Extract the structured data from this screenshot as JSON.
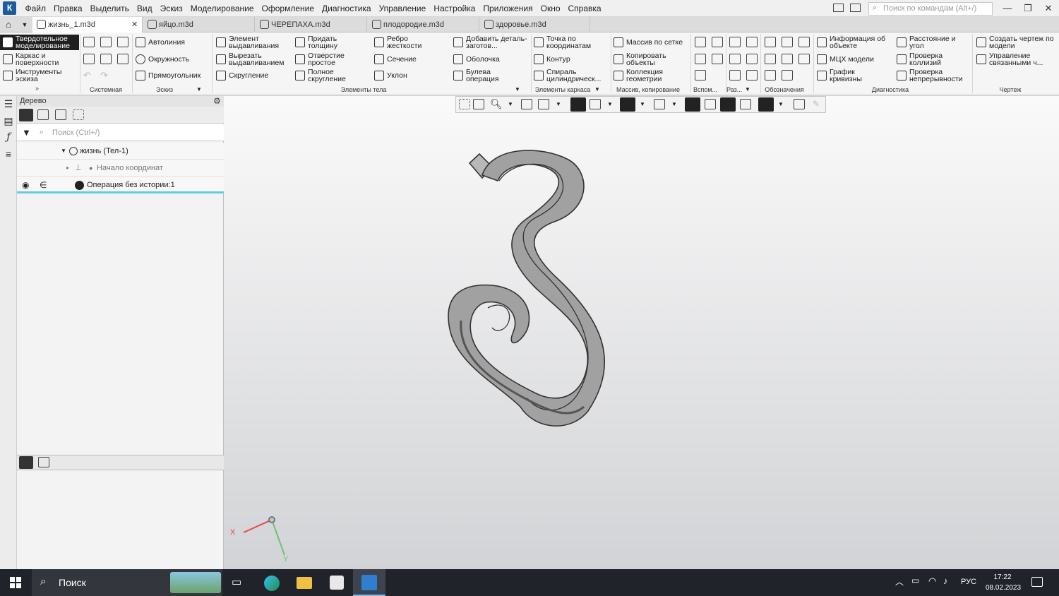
{
  "app": {
    "logo": "К"
  },
  "menu": [
    "Файл",
    "Правка",
    "Выделить",
    "Вид",
    "Эскиз",
    "Моделирование",
    "Оформление",
    "Диагностика",
    "Управление",
    "Настройка",
    "Приложения",
    "Окно",
    "Справка"
  ],
  "command_search": {
    "placeholder": "Поиск по командам (Alt+/)"
  },
  "tabs": [
    {
      "label": "жизнь_1.m3d",
      "close": "✕"
    },
    {
      "label": "яйцо.m3d"
    },
    {
      "label": "ЧЕРЕПАХА.m3d"
    },
    {
      "label": "плодородие.m3d"
    },
    {
      "label": "здоровье.m3d"
    }
  ],
  "ribbon": {
    "modes": [
      "Твердотельное моделирование",
      "Каркас и поверхности",
      "Инструменты эскиза"
    ],
    "sketch": [
      "Автолиния",
      "Окружность",
      "Прямоугольник"
    ],
    "body1": [
      "Элемент выдавливания",
      "Вырезать выдавливанием",
      "Скругление"
    ],
    "body2": [
      "Придать толщину",
      "Отверстие простое",
      "Полное скругление"
    ],
    "body3": [
      "Ребро жесткости",
      "Сечение",
      "Уклон"
    ],
    "body4": [
      "Добавить деталь-заготов...",
      "Оболочка",
      "Булева операция"
    ],
    "frame": [
      "Точка по координатам",
      "Контур",
      "Спираль цилиндрическ..."
    ],
    "arrays": [
      "Массив по сетке",
      "Копировать объекты",
      "Коллекция геометрии"
    ],
    "diag1": [
      "Информация об объекте",
      "МЦХ модели",
      "График кривизны"
    ],
    "diag2": [
      "Расстояние и угол",
      "Проверка коллизий",
      "Проверка непрерывности"
    ],
    "drawing": [
      "Создать чертеж по модели",
      "Управление связанными ч..."
    ],
    "groups": [
      "Системная",
      "Эскиз",
      "Элементы тела",
      "Элементы каркаса",
      "Массив, копирование",
      "Вспом...",
      "Раз...",
      "Обозначения",
      "Диагностика",
      "Чертеж"
    ]
  },
  "tree": {
    "title": "Дерево",
    "search_placeholder": "Поиск (Ctrl+/)",
    "items": [
      "жизнь (Тел-1)",
      "Начало координат",
      "Операция без истории:1"
    ]
  },
  "axes": {
    "x": "X",
    "y": "Y"
  },
  "taskbar": {
    "search": "Поиск",
    "lang": "РУС",
    "time": "17:22",
    "date": "08.02.2023"
  }
}
